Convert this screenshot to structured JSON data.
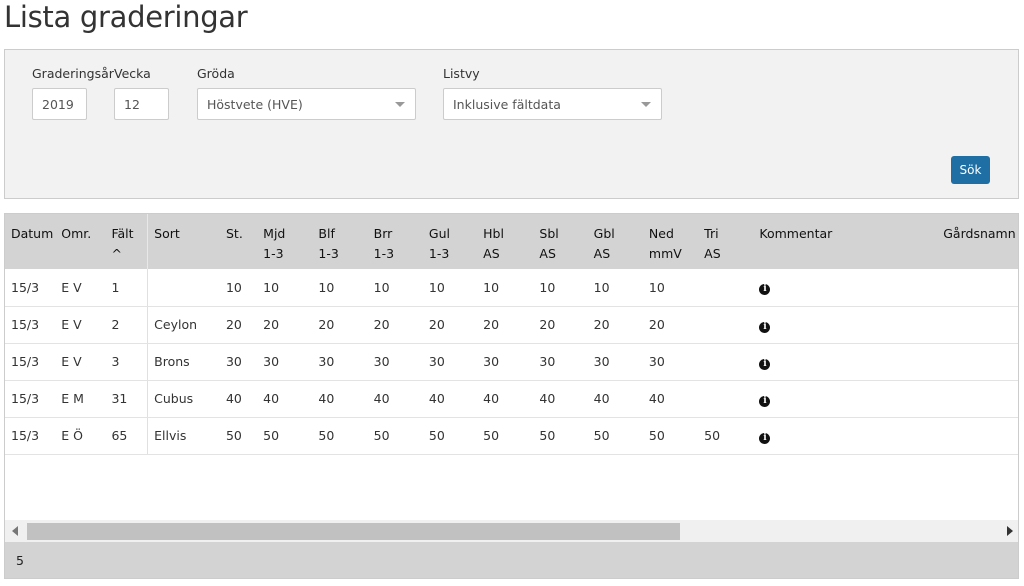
{
  "page_title": "Lista graderingar",
  "filters": {
    "year_label": "Graderingsår",
    "year_value": "2019",
    "week_label": "Vecka",
    "week_value": "12",
    "crop_label": "Gröda",
    "crop_value": "Höstvete (HVE)",
    "view_label": "Listvy",
    "view_value": "Inklusive fältdata",
    "search_button": "Sök"
  },
  "table": {
    "columns": [
      [
        "Datum",
        ""
      ],
      [
        "Omr.",
        ""
      ],
      [
        "Fält ^",
        ""
      ],
      [
        "Sort",
        ""
      ],
      [
        "St.",
        ""
      ],
      [
        "Mjd",
        "1-3"
      ],
      [
        "Blf",
        "1-3"
      ],
      [
        "Brr",
        "1-3"
      ],
      [
        "Gul",
        "1-3"
      ],
      [
        "Hbl",
        "AS"
      ],
      [
        "Sbl",
        "AS"
      ],
      [
        "Gbl",
        "AS"
      ],
      [
        "Ned",
        "mmV"
      ],
      [
        "Tri",
        "AS"
      ],
      [
        "Kommentar",
        ""
      ],
      [
        "Gårdsnamn",
        ""
      ]
    ],
    "rows": [
      [
        "15/3",
        "E V",
        "1",
        "",
        "10",
        "10",
        "10",
        "10",
        "10",
        "10",
        "10",
        "10",
        "10",
        "",
        "i",
        ""
      ],
      [
        "15/3",
        "E V",
        "2",
        "Ceylon",
        "20",
        "20",
        "20",
        "20",
        "20",
        "20",
        "20",
        "20",
        "20",
        "",
        "i",
        ""
      ],
      [
        "15/3",
        "E V",
        "3",
        "Brons",
        "30",
        "30",
        "30",
        "30",
        "30",
        "30",
        "30",
        "30",
        "30",
        "",
        "i",
        ""
      ],
      [
        "15/3",
        "E M",
        "31",
        "Cubus",
        "40",
        "40",
        "40",
        "40",
        "40",
        "40",
        "40",
        "40",
        "40",
        "",
        "i",
        ""
      ],
      [
        "15/3",
        "E Ö",
        "65",
        "Ellvis",
        "50",
        "50",
        "50",
        "50",
        "50",
        "50",
        "50",
        "50",
        "50",
        "50",
        "i",
        ""
      ]
    ],
    "row_count": "5",
    "horizontal_scroll_fraction": 0.66
  }
}
